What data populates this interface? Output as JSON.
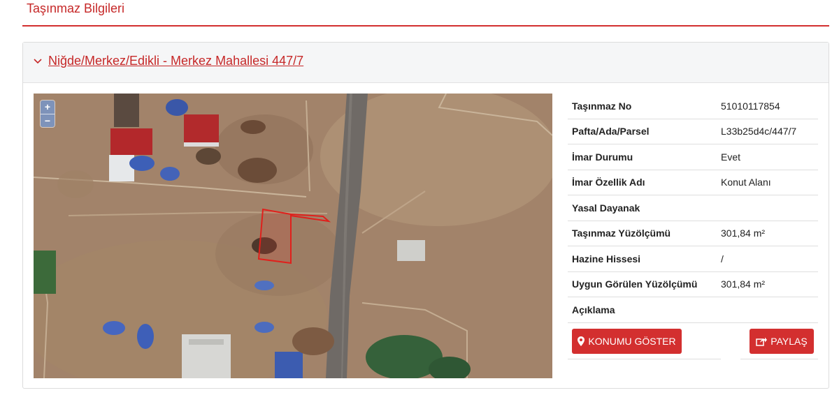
{
  "section": {
    "title": "Taşınmaz Bilgileri"
  },
  "panel": {
    "title": "Niğde/Merkez/Edikli - Merkez Mahallesi 447/7"
  },
  "map": {
    "zoom_in": "+",
    "zoom_out": "−"
  },
  "info": {
    "rows": [
      {
        "label": "Taşınmaz No",
        "value": "51010117854"
      },
      {
        "label": "Pafta/Ada/Parsel",
        "value": "L33b25d4c/447/7"
      },
      {
        "label": "İmar Durumu",
        "value": "Evet"
      },
      {
        "label": "İmar Özellik Adı",
        "value": "Konut Alanı"
      },
      {
        "label": "Yasal Dayanak",
        "value": ""
      },
      {
        "label": "Taşınmaz Yüzölçümü",
        "value": "301,84 m²"
      },
      {
        "label": "Hazine Hissesi",
        "value": "/"
      },
      {
        "label": "Uygun Görülen Yüzölçümü",
        "value": "301,84 m²"
      },
      {
        "label": "Açıklama",
        "value": ""
      }
    ]
  },
  "actions": {
    "show_location": "KONUMU GÖSTER",
    "share": "PAYLAŞ"
  },
  "colors": {
    "accent": "#d32f2f",
    "title": "#c62828",
    "parcel_outline": "#e0201c"
  },
  "icons": {
    "collapse": "chevron-down-icon",
    "location": "map-marker-icon",
    "share": "share-icon"
  }
}
